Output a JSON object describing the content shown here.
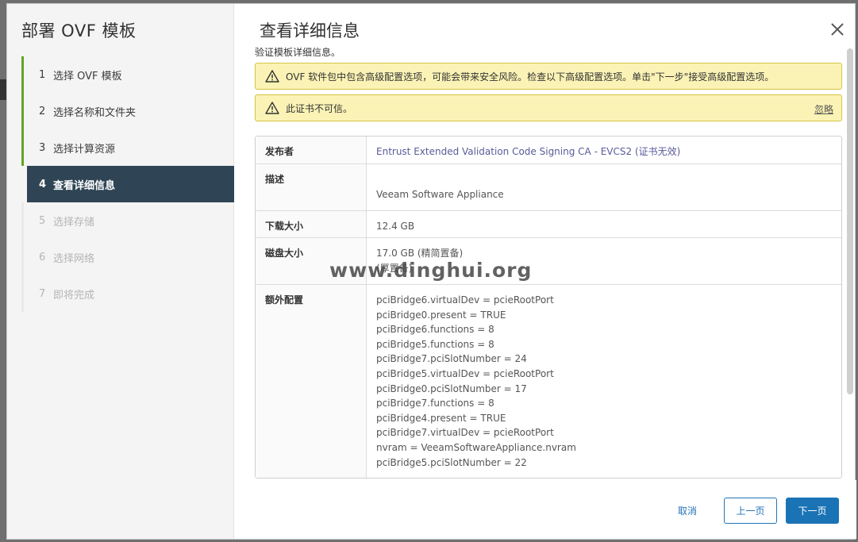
{
  "wizard": {
    "title": "部署 OVF 模板",
    "steps": [
      {
        "num": "1",
        "label": "选择 OVF 模板"
      },
      {
        "num": "2",
        "label": "选择名称和文件夹"
      },
      {
        "num": "3",
        "label": "选择计算资源"
      },
      {
        "num": "4",
        "label": "查看详细信息"
      },
      {
        "num": "5",
        "label": "选择存储"
      },
      {
        "num": "6",
        "label": "选择网络"
      },
      {
        "num": "7",
        "label": "即将完成"
      }
    ]
  },
  "main": {
    "title": "查看详细信息",
    "subtitle": "验证模板详细信息。",
    "alerts": [
      {
        "text": "OVF 软件包中包含高级配置选项，可能会带来安全风险。检查以下高级配置选项。单击\"下一步\"接受高级配置选项。"
      },
      {
        "text": "此证书不可信。",
        "action": "忽略"
      }
    ],
    "details": {
      "publisher_label": "发布者",
      "publisher_value": "Entrust Extended Validation Code Signing CA - EVCS2 (证书无效)",
      "description_label": "描述",
      "description_value": "Veeam Software Appliance",
      "download_label": "下载大小",
      "download_value": "12.4 GB",
      "disk_label": "磁盘大小",
      "disk_value_1": "17.0 GB (精简置备)",
      "disk_value_2": "(厚置备)",
      "extra_label": "额外配置",
      "extra_lines": [
        "pciBridge6.virtualDev = pcieRootPort",
        "pciBridge0.present = TRUE",
        "pciBridge6.functions = 8",
        "pciBridge5.functions = 8",
        "pciBridge7.pciSlotNumber = 24",
        "pciBridge5.virtualDev = pcieRootPort",
        "pciBridge0.pciSlotNumber = 17",
        "pciBridge7.functions = 8",
        "pciBridge4.present = TRUE",
        "pciBridge7.virtualDev = pcieRootPort",
        "nvram = VeeamSoftwareAppliance.nvram",
        "pciBridge5.pciSlotNumber = 22"
      ]
    }
  },
  "footer": {
    "cancel": "取消",
    "back": "上一页",
    "next": "下一页"
  },
  "watermark": "www.dinghui.org",
  "colors": {
    "sidebar_current_bg": "#2f4555",
    "step_done_bar": "#62a420",
    "alert_bg": "#fbf3b5",
    "primary": "#1a73b5"
  }
}
